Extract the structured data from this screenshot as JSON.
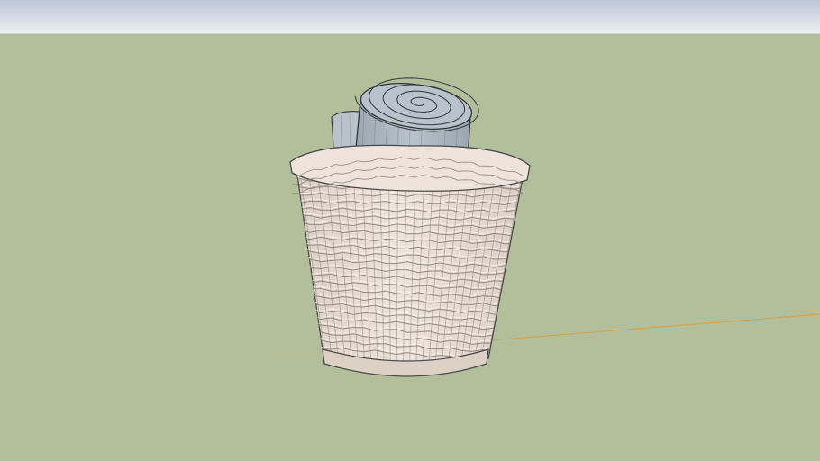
{
  "colors": {
    "sky_top": "#bcc6d5",
    "sky_bottom": "#eef1f6",
    "ground": "#b3bf9b",
    "horizon_line": "#b5bfa8",
    "axis_green": "#c0b987",
    "axis_red": "#d8a04a",
    "wicker_light": "#efe4db",
    "wicker_mid": "#ddd0c5",
    "wicker_dark": "#8e877f",
    "wicker_outline": "#4a4a4a",
    "towel_light": "#b8c3cc",
    "towel_mid": "#9aa6b0",
    "towel_dark": "#6b7580",
    "interior_shadow": "#7d766e"
  },
  "icons": {
    "model": "wicker-basket-with-rolled-towels"
  }
}
